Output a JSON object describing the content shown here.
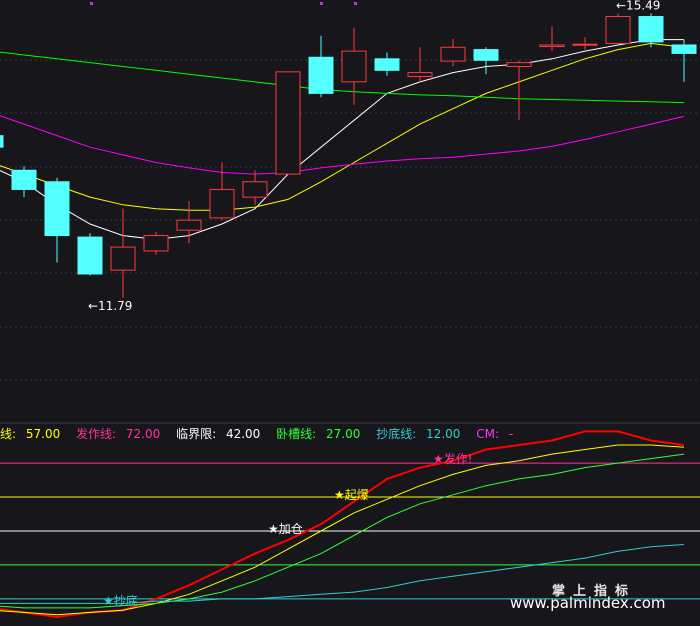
{
  "legend": [
    {
      "label": "线: ",
      "value": "57.00",
      "color": "#ffff00"
    },
    {
      "label": "发作线: ",
      "value": "72.00",
      "color": "#ff3399"
    },
    {
      "label": "临界限: ",
      "value": "42.00",
      "color": "#ffffff"
    },
    {
      "label": "卧槽线: ",
      "value": "27.00",
      "color": "#33ff33"
    },
    {
      "label": "抄底线: ",
      "value": "12.00",
      "color": "#33cccc"
    },
    {
      "label": "CM: ",
      "value": "-",
      "color": "#ff33ff"
    }
  ],
  "watermark": {
    "cn": "掌上指标",
    "url": "www.palmindex.com"
  },
  "chart_data": [
    {
      "type": "candlestick",
      "price_range": [
        10.2,
        15.6
      ],
      "price_labels": [
        {
          "text": "←11.79",
          "value": 11.79,
          "index": 3
        },
        {
          "text": "←15.49",
          "value": 15.49,
          "index": 19
        }
      ],
      "candles": [
        {
          "o": 13.9,
          "c": 13.75,
          "h": 14.0,
          "l": 13.6
        },
        {
          "o": 13.45,
          "c": 13.2,
          "h": 13.5,
          "l": 13.1
        },
        {
          "o": 13.3,
          "c": 12.6,
          "h": 13.35,
          "l": 12.25
        },
        {
          "o": 12.58,
          "c": 12.1,
          "h": 12.63,
          "l": 12.08
        },
        {
          "o": 12.15,
          "c": 12.45,
          "h": 12.95,
          "l": 11.79
        },
        {
          "o": 12.4,
          "c": 12.6,
          "h": 12.65,
          "l": 12.35
        },
        {
          "o": 12.67,
          "c": 12.8,
          "h": 13.05,
          "l": 12.5
        },
        {
          "o": 12.83,
          "c": 13.2,
          "h": 13.55,
          "l": 12.8
        },
        {
          "o": 13.1,
          "c": 13.3,
          "h": 13.45,
          "l": 13.0
        },
        {
          "o": 13.4,
          "c": 14.73,
          "h": 14.73,
          "l": 13.4
        },
        {
          "o": 14.92,
          "c": 14.45,
          "h": 15.2,
          "l": 14.4
        },
        {
          "o": 14.6,
          "c": 15.0,
          "h": 15.3,
          "l": 14.3
        },
        {
          "o": 14.9,
          "c": 14.75,
          "h": 14.98,
          "l": 14.68
        },
        {
          "o": 14.67,
          "c": 14.72,
          "h": 15.05,
          "l": 14.6
        },
        {
          "o": 14.87,
          "c": 15.05,
          "h": 15.16,
          "l": 14.8
        },
        {
          "o": 15.02,
          "c": 14.88,
          "h": 15.05,
          "l": 14.7
        },
        {
          "o": 14.8,
          "c": 14.85,
          "h": 14.88,
          "l": 14.1
        },
        {
          "o": 15.06,
          "c": 15.08,
          "h": 15.32,
          "l": 15.0
        },
        {
          "o": 15.08,
          "c": 15.09,
          "h": 15.18,
          "l": 15.02
        },
        {
          "o": 15.1,
          "c": 15.45,
          "h": 15.49,
          "l": 15.1
        },
        {
          "o": 15.45,
          "c": 15.12,
          "h": 15.49,
          "l": 15.05
        },
        {
          "o": 15.08,
          "c": 14.97,
          "h": 15.15,
          "l": 14.6
        }
      ],
      "moving_averages": [
        {
          "color": "#ffffff",
          "values": [
            13.5,
            13.3,
            13.0,
            12.75,
            12.6,
            12.55,
            12.6,
            12.75,
            12.95,
            13.4,
            13.75,
            14.1,
            14.45,
            14.6,
            14.72,
            14.8,
            14.83,
            14.9,
            15.0,
            15.08,
            15.15,
            15.15
          ]
        },
        {
          "color": "#ffff00",
          "values": [
            13.55,
            13.4,
            13.25,
            13.1,
            13.0,
            12.95,
            12.93,
            12.93,
            12.97,
            13.07,
            13.3,
            13.55,
            13.8,
            14.05,
            14.25,
            14.45,
            14.6,
            14.75,
            14.9,
            15.02,
            15.1,
            15.05
          ]
        },
        {
          "color": "#ff00ff",
          "values": [
            14.2,
            14.05,
            13.9,
            13.75,
            13.65,
            13.55,
            13.48,
            13.42,
            13.4,
            13.42,
            13.48,
            13.53,
            13.57,
            13.6,
            13.62,
            13.66,
            13.7,
            13.76,
            13.85,
            13.95,
            14.05,
            14.15
          ]
        },
        {
          "color": "#00ff00",
          "values": [
            15.0,
            14.95,
            14.9,
            14.85,
            14.8,
            14.75,
            14.7,
            14.65,
            14.6,
            14.55,
            14.5,
            14.47,
            14.45,
            14.43,
            14.42,
            14.4,
            14.38,
            14.37,
            14.36,
            14.35,
            14.34,
            14.33
          ]
        }
      ]
    },
    {
      "type": "line",
      "y_range": [
        0,
        80
      ],
      "thresholds": [
        {
          "value": 72,
          "color": "#ff3399"
        },
        {
          "value": 57,
          "color": "#ffff00"
        },
        {
          "value": 42,
          "color": "#ffffff"
        },
        {
          "value": 27,
          "color": "#33ff33"
        },
        {
          "value": 12,
          "color": "#33cccc"
        }
      ],
      "series": [
        {
          "color": "#ff0000",
          "values": [
            8,
            6,
            4,
            6,
            7,
            12,
            18,
            25,
            32,
            38,
            45,
            55,
            65,
            70,
            73,
            78,
            80,
            82,
            86,
            86,
            82,
            80
          ]
        },
        {
          "color": "#ffff00",
          "values": [
            7,
            6,
            5,
            6,
            7,
            10,
            14,
            20,
            26,
            34,
            42,
            50,
            56,
            62,
            67,
            71,
            73,
            76,
            78,
            80,
            80,
            79
          ]
        },
        {
          "color": "#33ff33",
          "values": [
            9,
            8,
            8,
            8,
            9,
            10,
            12,
            15,
            20,
            26,
            32,
            40,
            48,
            54,
            58,
            62,
            65,
            67,
            70,
            72,
            74,
            76
          ]
        },
        {
          "color": "#33cccc",
          "values": [
            10,
            10,
            10,
            10,
            10,
            11,
            11,
            12,
            12,
            13,
            14,
            15,
            17,
            20,
            22,
            24,
            26,
            28,
            30,
            33,
            35,
            36
          ]
        }
      ],
      "signals": [
        {
          "text": "★加仓",
          "index": 9,
          "value": 42,
          "color": "#ffffff"
        },
        {
          "text": "★起爆",
          "index": 11,
          "value": 57,
          "color": "#ffff00"
        },
        {
          "text": "★发作!",
          "index": 14,
          "value": 73,
          "color": "#ff3399"
        },
        {
          "text": "★抄底",
          "index": 4,
          "value": 12,
          "color": "#33cccc"
        }
      ]
    }
  ]
}
